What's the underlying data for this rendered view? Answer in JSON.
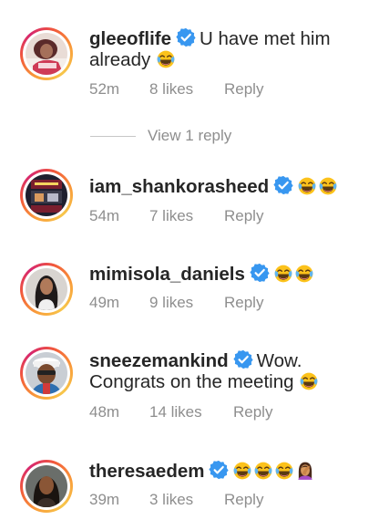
{
  "comments": [
    {
      "username": "gleeoflife",
      "text_line1": "U have met him",
      "text_line2": "already",
      "time": "52m",
      "likes": "8 likes",
      "reply_label": "Reply"
    },
    {
      "username": "iam_shankorasheed",
      "time": "54m",
      "likes": "7 likes",
      "reply_label": "Reply"
    },
    {
      "username": "mimisola_daniels",
      "time": "49m",
      "likes": "9 likes",
      "reply_label": "Reply"
    },
    {
      "username": "sneezemankind",
      "text_line1": "Wow.",
      "text_line2": "Congrats on the meeting",
      "time": "48m",
      "likes": "14 likes",
      "reply_label": "Reply"
    },
    {
      "username": "theresaedem",
      "time": "39m",
      "likes": "3 likes",
      "reply_label": "Reply"
    }
  ],
  "view_replies": "View 1 reply",
  "colors": {
    "verified": "#3897f0",
    "meta_text": "#8e8e8e",
    "username": "#262626"
  },
  "icons": {
    "verified": "verified-badge-icon",
    "laugh_emoji": "tears-of-joy-emoji",
    "facepalm_emoji": "woman-facepalming-emoji"
  }
}
